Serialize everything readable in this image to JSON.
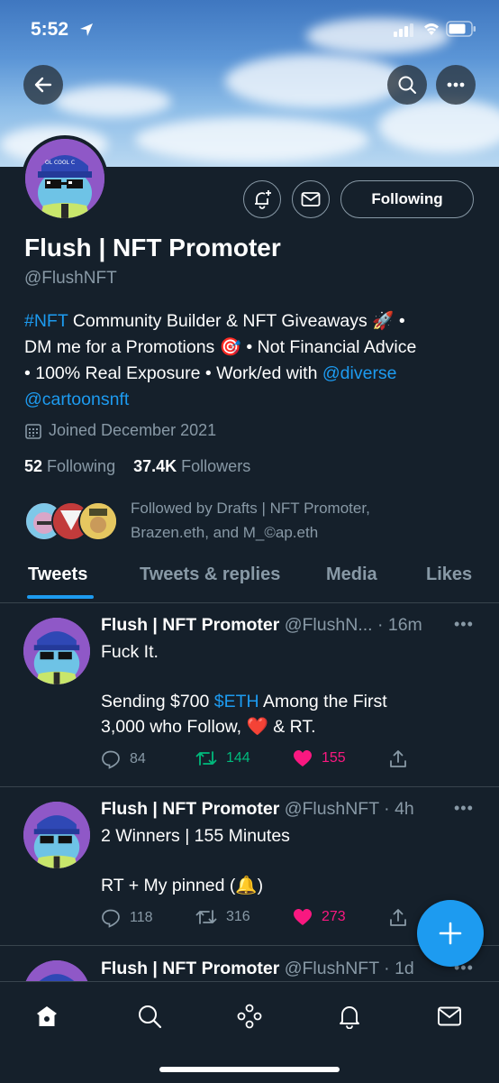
{
  "status_bar": {
    "time": "5:52"
  },
  "profile": {
    "name": "Flush | NFT Promoter",
    "handle": "@FlushNFT",
    "bio_line1_tag": "#NFT",
    "bio_line1_rest": " Community Builder & NFT Giveaways 🚀 •",
    "bio_line2": "DM me for a Promotions 🎯 • Not Financial Advice",
    "bio_line3_rest": "• 100% Real Exposure • Work/ed with ",
    "bio_mention1": "@diverse",
    "bio_mention2": "@cartoonsnft",
    "joined": "Joined December 2021",
    "following_count": "52",
    "following_label": "Following",
    "followers_count": "37.4K",
    "followers_label": "Followers",
    "followed_by": "Followed by Drafts | NFT Promoter, Brazen.eth, and M_©ap.eth",
    "following_button": "Following"
  },
  "tabs": [
    "Tweets",
    "Tweets & replies",
    "Media",
    "Likes"
  ],
  "tweets": [
    {
      "name": "Flush | NFT Promoter",
      "meta": "@FlushN... · 16m",
      "line1": "Fuck It.",
      "line2_pre": "Sending $700 ",
      "line2_tag": "$ETH",
      "line2_post": " Among the First",
      "line3": "3,000 who Follow, ❤️ & RT.",
      "replies": "84",
      "retweets": "144",
      "likes": "155"
    },
    {
      "name": "Flush | NFT Promoter",
      "meta": "@FlushNFT · 4h",
      "line1": "2 Winners | 155 Minutes",
      "line2": "RT + My pinned (🔔)",
      "replies": "118",
      "retweets": "316",
      "likes": "273"
    },
    {
      "name": "Flush | NFT Promoter",
      "meta": "@FlushNFT · 1d"
    }
  ],
  "colors": {
    "accent": "#1d9bf0",
    "background": "#15202b",
    "like": "#f91880",
    "retweet": "#00ba7c",
    "muted": "#8899a6"
  }
}
